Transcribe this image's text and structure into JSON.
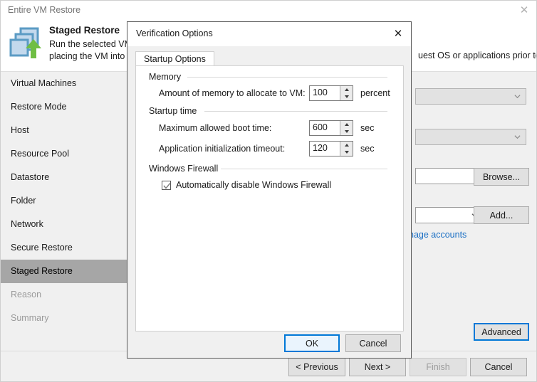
{
  "window": {
    "title": "Entire VM Restore",
    "close_icon": "close-icon"
  },
  "header": {
    "title": "Staged Restore",
    "description": "Run the selected VM                                     uest OS or applications prior to",
    "description_line1": "Run the selected VM",
    "description_line2": "placing the VM into",
    "description_right": "uest OS or applications prior to",
    "icon": "staged-restore-icon"
  },
  "sidebar": {
    "items": [
      {
        "label": "Virtual Machines",
        "state": "normal"
      },
      {
        "label": "Restore Mode",
        "state": "normal"
      },
      {
        "label": "Host",
        "state": "normal"
      },
      {
        "label": "Resource Pool",
        "state": "normal"
      },
      {
        "label": "Datastore",
        "state": "normal"
      },
      {
        "label": "Folder",
        "state": "normal"
      },
      {
        "label": "Network",
        "state": "normal"
      },
      {
        "label": "Secure Restore",
        "state": "normal"
      },
      {
        "label": "Staged Restore",
        "state": "selected"
      },
      {
        "label": "Reason",
        "state": "disabled"
      },
      {
        "label": "Summary",
        "state": "disabled"
      }
    ]
  },
  "content": {
    "combo1_value": "",
    "combo2_value": "",
    "textbox_value": "",
    "combo3_value": "",
    "browse_label": "Browse...",
    "add_label": "Add...",
    "manage_accounts_label": "nage accounts",
    "advanced_label": "Advanced"
  },
  "wizard_footer": {
    "previous_label": "< Previous",
    "next_label": "Next >",
    "finish_label": "Finish",
    "cancel_label": "Cancel"
  },
  "modal": {
    "title": "Verification Options",
    "close_icon": "close-icon",
    "tab_label": "Startup Options",
    "groups": {
      "memory": {
        "title": "Memory",
        "field_label": "Amount of memory to allocate to VM:",
        "value": "100",
        "unit": "percent"
      },
      "startup_time": {
        "title": "Startup time",
        "boot_label": "Maximum allowed boot time:",
        "boot_value": "600",
        "boot_unit": "sec",
        "appinit_label": "Application initialization timeout:",
        "appinit_value": "120",
        "appinit_unit": "sec"
      },
      "firewall": {
        "title": "Windows Firewall",
        "checkbox_label": "Automatically disable Windows Firewall",
        "checked": true
      }
    },
    "ok_label": "OK",
    "cancel_label": "Cancel"
  },
  "colors": {
    "accent": "#0078d7",
    "selection": "#a6a6a6",
    "link": "#1a6fc4",
    "icon_blue_border": "#5b9bc4",
    "icon_blue_fill": "#c3d9ed",
    "icon_green": "#6fbe44"
  }
}
